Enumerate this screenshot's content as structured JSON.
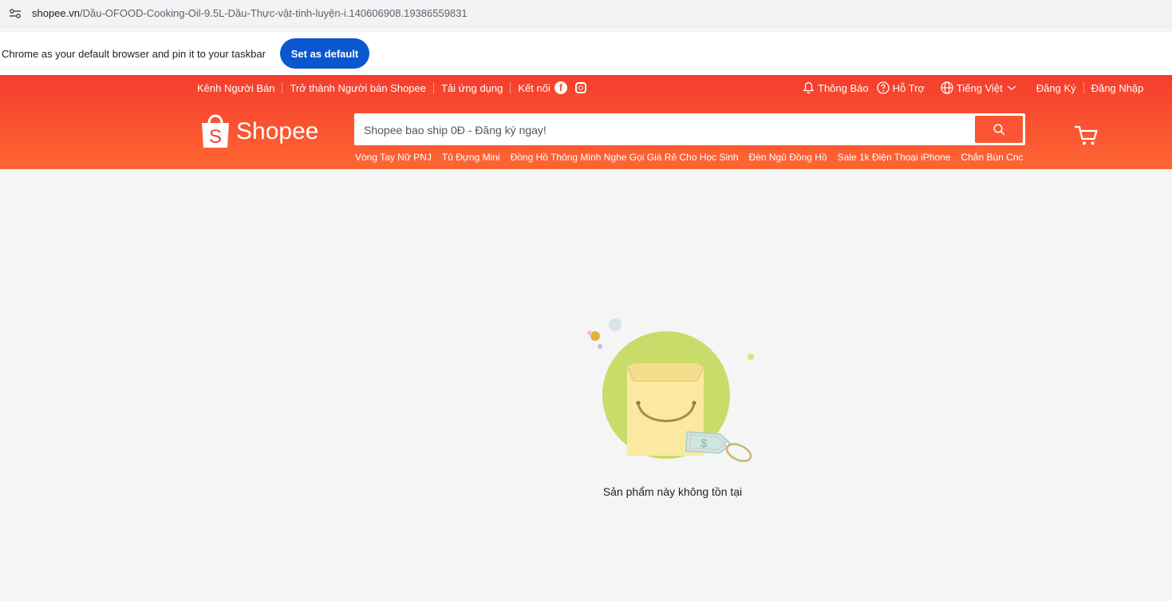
{
  "browser": {
    "url_host": "shopee.vn",
    "url_path": "/Dầu-OFOOD-Cooking-Oil-9.5L-Dầu-Thực-vật-tinh-luyện-i.140606908.19386559831",
    "site_info_icon": "tune-icon"
  },
  "infobar": {
    "message": "Chrome as your default browser and pin it to your taskbar",
    "button_label": "Set as default"
  },
  "navbar": {
    "left": [
      "Kênh Người Bán",
      "Trở thành Người bán Shopee",
      "Tải ứng dụng",
      "Kết nối"
    ],
    "facebook_glyph": "f",
    "notifications": "Thông Báo",
    "help": "Hỗ Trợ",
    "language": "Tiếng Việt",
    "register": "Đăng Ký",
    "login": "Đăng Nhập"
  },
  "header": {
    "logo_text": "Shopee",
    "logo_glyph": "S",
    "search_placeholder": "Shopee bao ship 0Đ - Đăng ký ngay!",
    "keywords": [
      "Vòng Tay Nữ PNJ",
      "Tủ Đựng Mini",
      "Đồng Hồ Thông Minh Nghe Gọi Giá Rẻ Cho Học Sinh",
      "Đèn Ngủ Đồng Hồ",
      "Sale 1k Điện Thoại iPhone",
      "Chắn Bùn Cnc"
    ],
    "brand_color": "#ee4d2d"
  },
  "main": {
    "empty_message": "Sản phẩm này không tồn tại",
    "tag_glyph": "$"
  }
}
